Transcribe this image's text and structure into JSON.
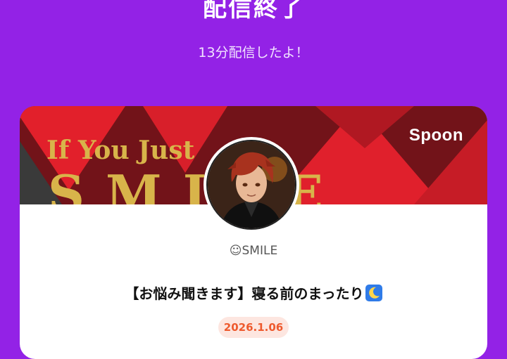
{
  "header": {
    "title": "配信終了",
    "subtitle": "13分配信したよ！"
  },
  "card": {
    "banner_text_line1": "If You Just",
    "banner_text_line2": "SMILE",
    "brand": "Spoon",
    "username": "☺SMILE",
    "live_title": "【お悩み聞きます】寝る前のまったり",
    "title_emoji_icon": "crescent-moon-icon",
    "date": "2026.1.06"
  },
  "colors": {
    "background": "#9322e6",
    "card": "#ffffff",
    "date_badge_bg": "#fde6e0",
    "date_badge_text": "#ee5a2e"
  }
}
